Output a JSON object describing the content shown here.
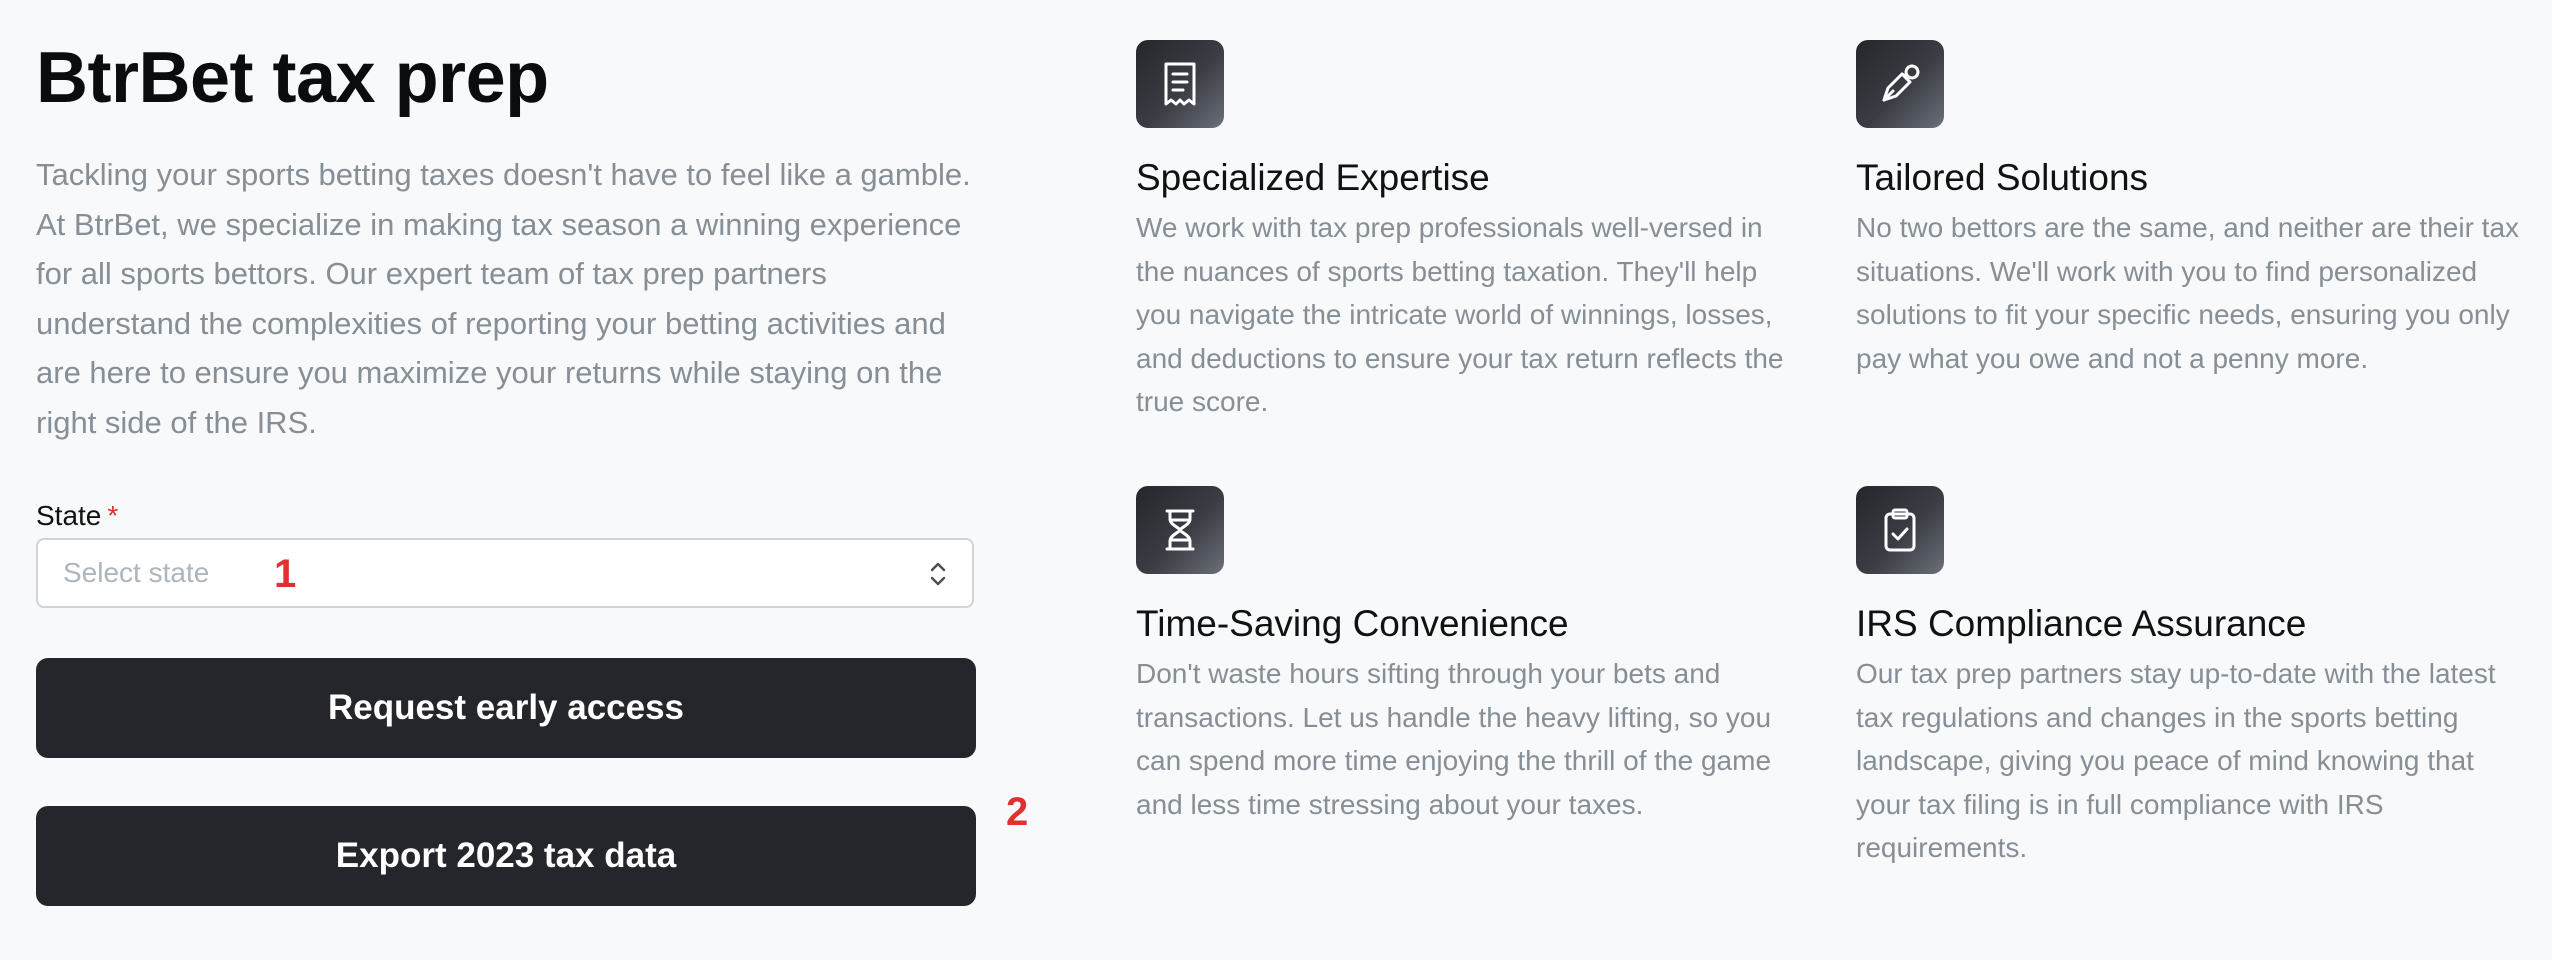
{
  "title": "BtrBet tax prep",
  "description": "Tackling your sports betting taxes doesn't have to feel like a gamble. At BtrBet, we specialize in making tax season a winning experience for all sports bettors. Our expert team of tax prep partners understand the complexities of reporting your betting activities and are here to ensure you maximize your returns while staying on the right side of the IRS.",
  "form": {
    "state_label": "State",
    "required_mark": "*",
    "state_placeholder": "Select state",
    "request_button": "Request early access",
    "export_button": "Export 2023 tax data"
  },
  "markers": {
    "one": "1",
    "two": "2"
  },
  "features": [
    {
      "icon": "receipt-icon",
      "title": "Specialized Expertise",
      "text": "We work with tax prep professionals well-versed in the nuances of sports betting taxation. They'll help you navigate the intricate world of winnings, losses, and deductions to ensure your tax return reflects the true score."
    },
    {
      "icon": "pen-tool-icon",
      "title": "Tailored Solutions",
      "text": "No two bettors are the same, and neither are their tax situations. We'll work with you to find personalized solutions to fit your specific needs, ensuring you only pay what you owe and not a penny more."
    },
    {
      "icon": "hourglass-icon",
      "title": "Time-Saving Convenience",
      "text": "Don't waste hours sifting through your bets and transactions. Let us handle the heavy lifting, so you can spend more time enjoying the thrill of the game and less time stressing about your taxes."
    },
    {
      "icon": "clipboard-check-icon",
      "title": "IRS Compliance Assurance",
      "text": "Our tax prep partners stay up-to-date with the latest tax regulations and changes in the sports betting landscape, giving you peace of mind knowing that your tax filing is in full compliance with IRS requirements."
    }
  ],
  "colors": {
    "background": "#f8f9fa",
    "button": "#25262b",
    "muted_text": "#868e96",
    "required": "#e03131",
    "marker": "#e03131"
  }
}
